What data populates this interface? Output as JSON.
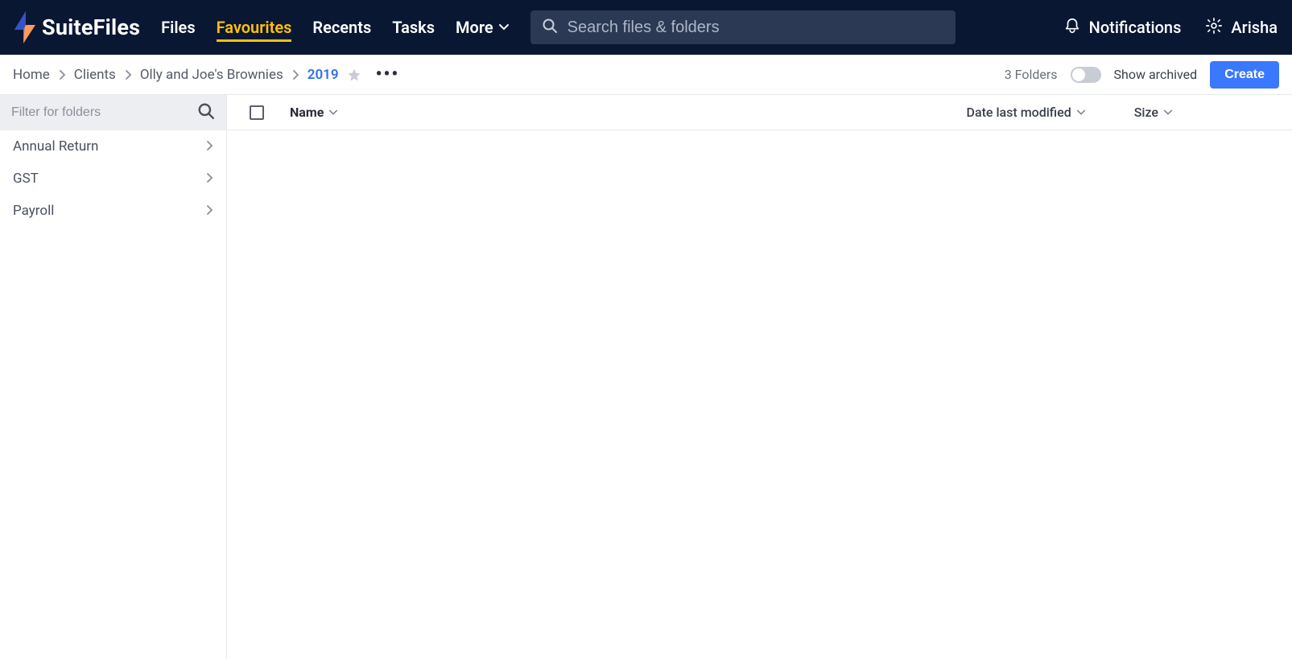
{
  "brand": {
    "name": "SuiteFiles"
  },
  "nav": {
    "files": "Files",
    "favourites": "Favourites",
    "recents": "Recents",
    "tasks": "Tasks",
    "more": "More"
  },
  "search": {
    "placeholder": "Search files & folders"
  },
  "header_actions": {
    "notifications": "Notifications",
    "user_name": "Arisha"
  },
  "breadcrumbs": {
    "items": [
      {
        "label": "Home"
      },
      {
        "label": "Clients"
      },
      {
        "label": "Olly and Joe's Brownies"
      },
      {
        "label": "2019"
      }
    ]
  },
  "subbar": {
    "folder_count": "3 Folders",
    "show_archived": "Show archived",
    "create": "Create"
  },
  "sidebar": {
    "filter_placeholder": "Filter for folders",
    "folders": [
      {
        "label": "Annual Return"
      },
      {
        "label": "GST"
      },
      {
        "label": "Payroll"
      }
    ]
  },
  "columns": {
    "name": "Name",
    "modified": "Date last modified",
    "size": "Size"
  }
}
